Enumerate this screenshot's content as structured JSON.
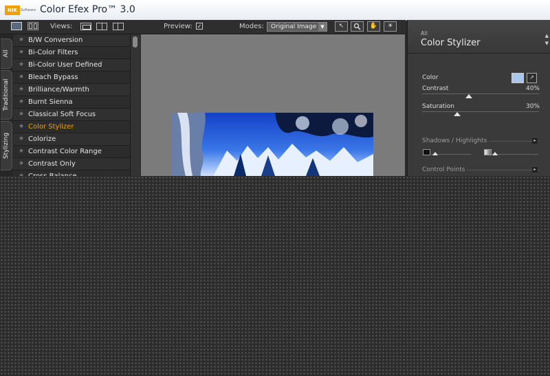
{
  "app": {
    "logo_brand": "NIK",
    "logo_sub": "Software",
    "title": "Color Efex Pro™ 3.0"
  },
  "toolbar": {
    "views_label": "Views:",
    "preview_label": "Preview:",
    "preview_checked": "✓",
    "modes_label": "Modes:",
    "modes_value": "Original Image",
    "modes_arrow": "▼",
    "tools": [
      "↖",
      "🔍",
      "✋",
      "☀"
    ]
  },
  "sidetabs": [
    "All",
    "Traditional",
    "Stylizing"
  ],
  "filters": [
    {
      "label": "B/W Conversion",
      "active": false
    },
    {
      "label": "Bi-Color Filters",
      "active": false
    },
    {
      "label": "Bi-Color User Defined",
      "active": false
    },
    {
      "label": "Bleach Bypass",
      "active": false
    },
    {
      "label": "Brilliance/Warmth",
      "active": false
    },
    {
      "label": "Burnt Sienna",
      "active": false
    },
    {
      "label": "Classical Soft Focus",
      "active": false
    },
    {
      "label": "Color Stylizer",
      "active": true
    },
    {
      "label": "Colorize",
      "active": false
    },
    {
      "label": "Contrast Color Range",
      "active": false
    },
    {
      "label": "Contrast Only",
      "active": false
    },
    {
      "label": "Cross Balance",
      "active": false
    }
  ],
  "star_glyph": "★",
  "right_panel": {
    "category": "All",
    "filter_title": "Color Stylizer",
    "arrow_up": "▲",
    "arrow_down": "▼",
    "color_label": "Color",
    "color_swatch": "#aac6ec",
    "picker_glyph": "↗",
    "contrast_label": "Contrast",
    "contrast_value": "40%",
    "contrast_level": 0.4,
    "saturation_label": "Saturation",
    "saturation_value": "30%",
    "saturation_level": 0.3,
    "shadows_label": "Shadows / Highlights",
    "control_points_label": "Control Points",
    "section_arrow": "▸"
  },
  "colors": {
    "accent": "#f0a018",
    "panel_bg": "#3a3a3a",
    "canvas_bg": "#7b7b7b"
  }
}
